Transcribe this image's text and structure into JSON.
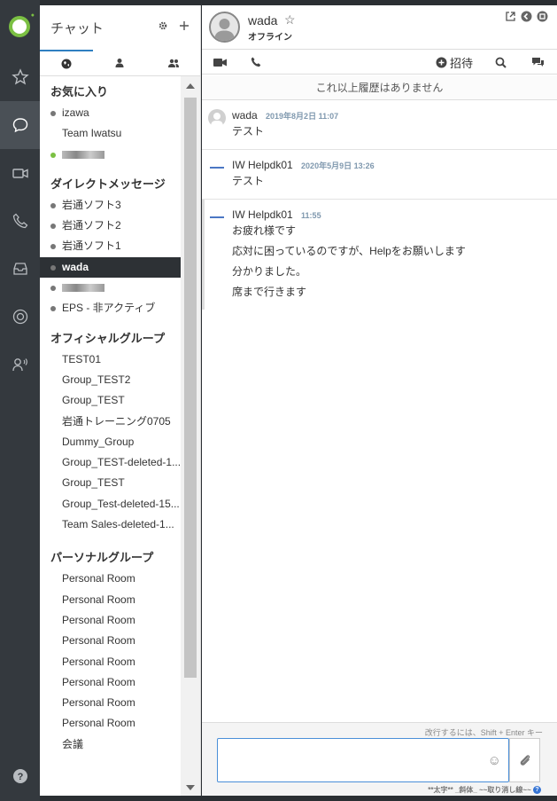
{
  "left_panel": {
    "title": "チャット",
    "sections": {
      "favorites": {
        "title": "お気に入り"
      },
      "direct": {
        "title": "ダイレクトメッセージ"
      },
      "official": {
        "title": "オフィシャルグループ"
      },
      "personal": {
        "title": "パーソナルグループ"
      }
    },
    "favorites": [
      "izawa",
      "Team Iwatsu"
    ],
    "direct": [
      "岩通ソフト3",
      "岩通ソフト2",
      "岩通ソフト1",
      "wada",
      "EPS - 非アクティブ"
    ],
    "official": [
      "TEST01",
      "Group_TEST2",
      "Group_TEST",
      "岩通トレーニング0705",
      "Dummy_Group",
      "Group_TEST-deleted-1...",
      "Group_TEST",
      "Group_Test-deleted-15...",
      "Team Sales-deleted-1..."
    ],
    "personal": [
      "Personal Room",
      "Personal Room",
      "Personal Room",
      "Personal Room",
      "Personal Room",
      "Personal Room",
      "Personal Room",
      "Personal Room",
      "会議"
    ]
  },
  "header": {
    "name": "wada",
    "status": "オフライン"
  },
  "toolbar": {
    "invite_label": "招待"
  },
  "messages": {
    "no_more": "これ以上履歴はありません",
    "items": [
      {
        "from": "wada",
        "time": "2019年8月2日 11:07",
        "lines": [
          "テスト"
        ]
      },
      {
        "from": "IW Helpdk01",
        "time": "2020年5月9日 13:26",
        "lines": [
          "テスト"
        ]
      },
      {
        "from": "IW Helpdk01",
        "time": "11:55",
        "lines": [
          "お疲れ様です",
          "応対に困っているのですが、Helpをお願いします",
          "分かりました。",
          "席まで行きます"
        ]
      }
    ]
  },
  "composer": {
    "hint": "改行するには、Shift + Enter キー",
    "format_help": "**太字** _斜体_ ~~取り消し線~~"
  },
  "colors": {
    "accent": "#2f7fc1",
    "online": "#7bc043",
    "rail": "#34393e"
  }
}
